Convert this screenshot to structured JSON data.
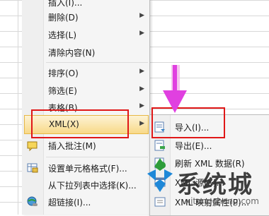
{
  "context_menu": {
    "items": [
      {
        "label": "插入(I)...",
        "icon": "none",
        "submenu": false
      },
      {
        "label": "删除(D)",
        "icon": "none",
        "submenu": true
      },
      {
        "label": "选择(L)",
        "icon": "none",
        "submenu": true
      },
      {
        "label": "清除内容(N)",
        "icon": "none",
        "submenu": false
      },
      {
        "label": "排序(O)",
        "icon": "none",
        "submenu": true
      },
      {
        "label": "筛选(E)",
        "icon": "none",
        "submenu": true
      },
      {
        "label": "表格(B)",
        "icon": "none",
        "submenu": true
      },
      {
        "label": "XML(X)",
        "icon": "none",
        "submenu": true
      },
      {
        "label": "插入批注(M)",
        "icon": "comment-icon",
        "submenu": false
      },
      {
        "label": "设置单元格格式(F)...",
        "icon": "format-cells-icon",
        "submenu": false
      },
      {
        "label": "从下拉列表中选择(K)...",
        "icon": "none",
        "submenu": false
      },
      {
        "label": "超链接(I)...",
        "icon": "hyperlink-icon",
        "submenu": false
      }
    ]
  },
  "xml_submenu": {
    "items": [
      {
        "label": "导入(I)...",
        "icon": "import-icon"
      },
      {
        "label": "导出(E)...",
        "icon": "export-icon"
      },
      {
        "label": "刷新 XML 数据(R)",
        "icon": "refresh-icon"
      },
      {
        "label": "XML 源(X)...",
        "icon": "xml-source-icon"
      },
      {
        "label": "XML 映射属性(P)...",
        "icon": "map-properties-icon"
      }
    ]
  },
  "watermark": {
    "text": "系统城",
    "url": "xitongcheng.com"
  },
  "colors": {
    "highlight": "#f8d988",
    "red_box": "#e01818",
    "arrow": "#e040e0"
  }
}
